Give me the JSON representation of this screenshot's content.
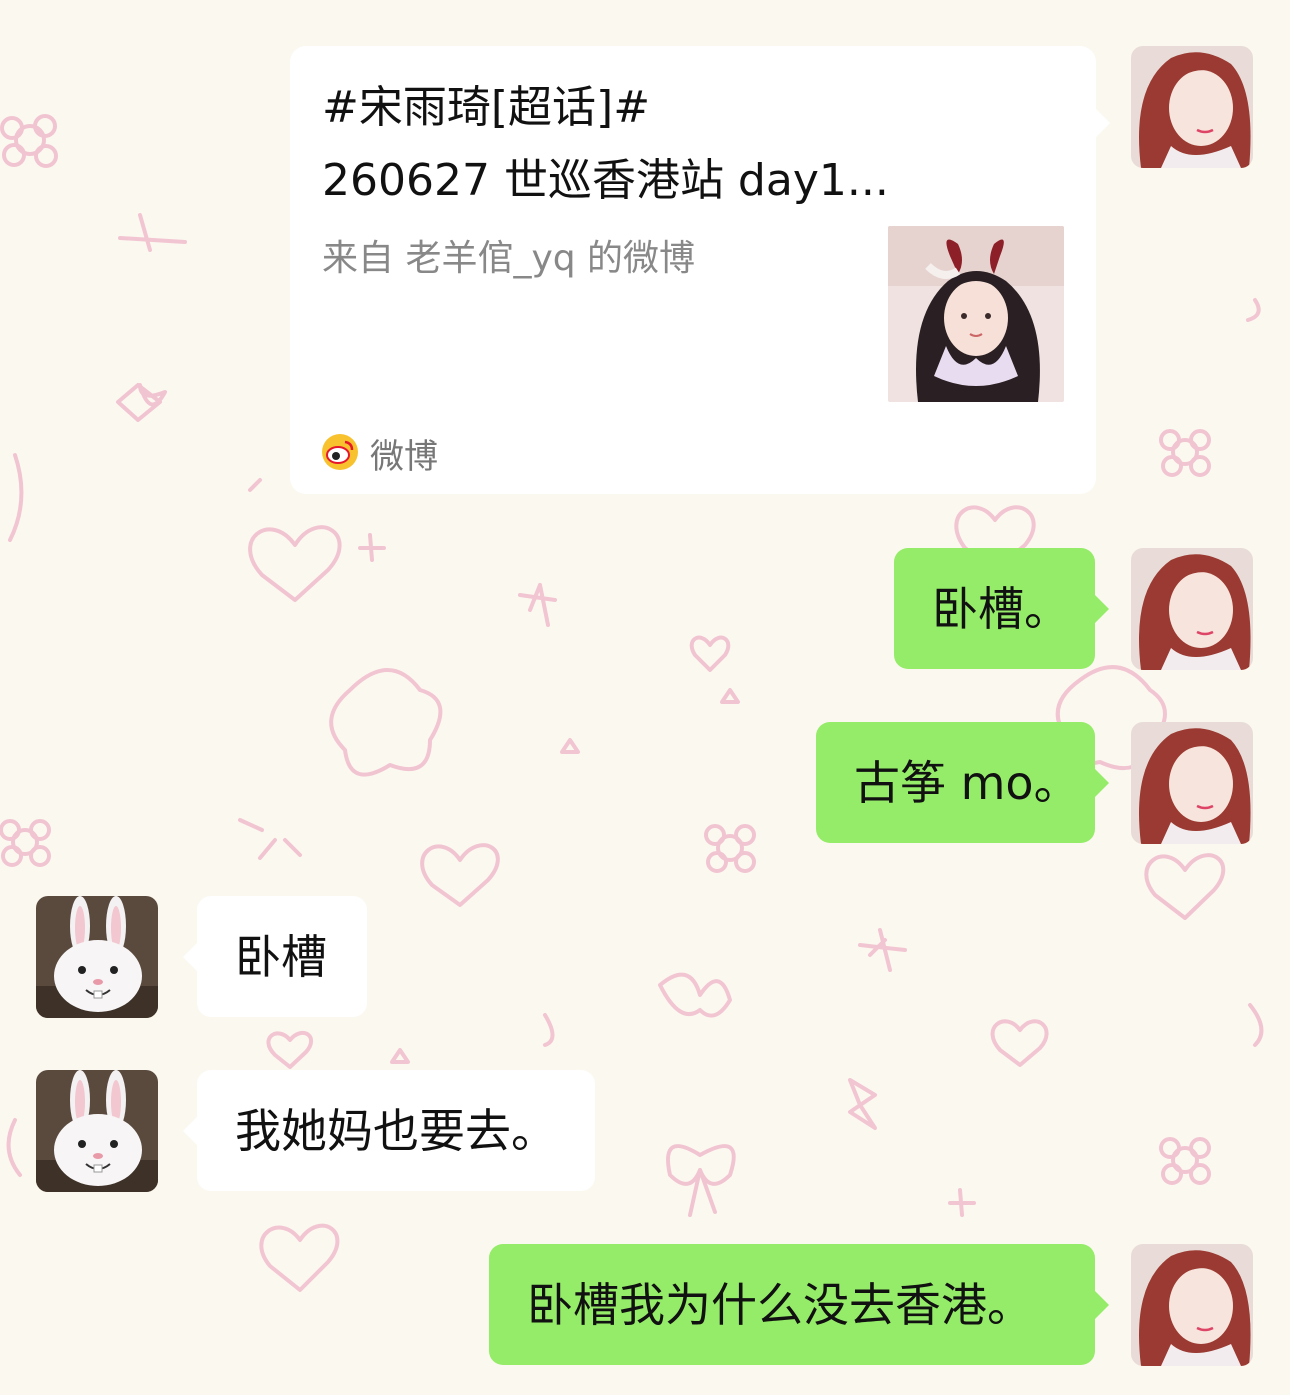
{
  "chat": {
    "share_card": {
      "title": "#宋雨琦[超话]#",
      "subtitle": "260627 世巡香港站 day1...",
      "source": "来自 老羊倌_yq 的微博",
      "app_label": "微博",
      "app_icon": "weibo-icon"
    },
    "messages": [
      {
        "side": "out",
        "text": "卧槽。"
      },
      {
        "side": "out",
        "text": "古筝 mo。"
      },
      {
        "side": "in",
        "text": "卧槽"
      },
      {
        "side": "in",
        "text": "我她妈也要去。"
      },
      {
        "side": "out",
        "text": "卧槽我为什么没去香港。"
      }
    ]
  },
  "colors": {
    "background": "#fbf8ef",
    "outgoing_bubble": "#95ec69",
    "incoming_bubble": "#ffffff",
    "doodle": "#f0b8cc"
  }
}
